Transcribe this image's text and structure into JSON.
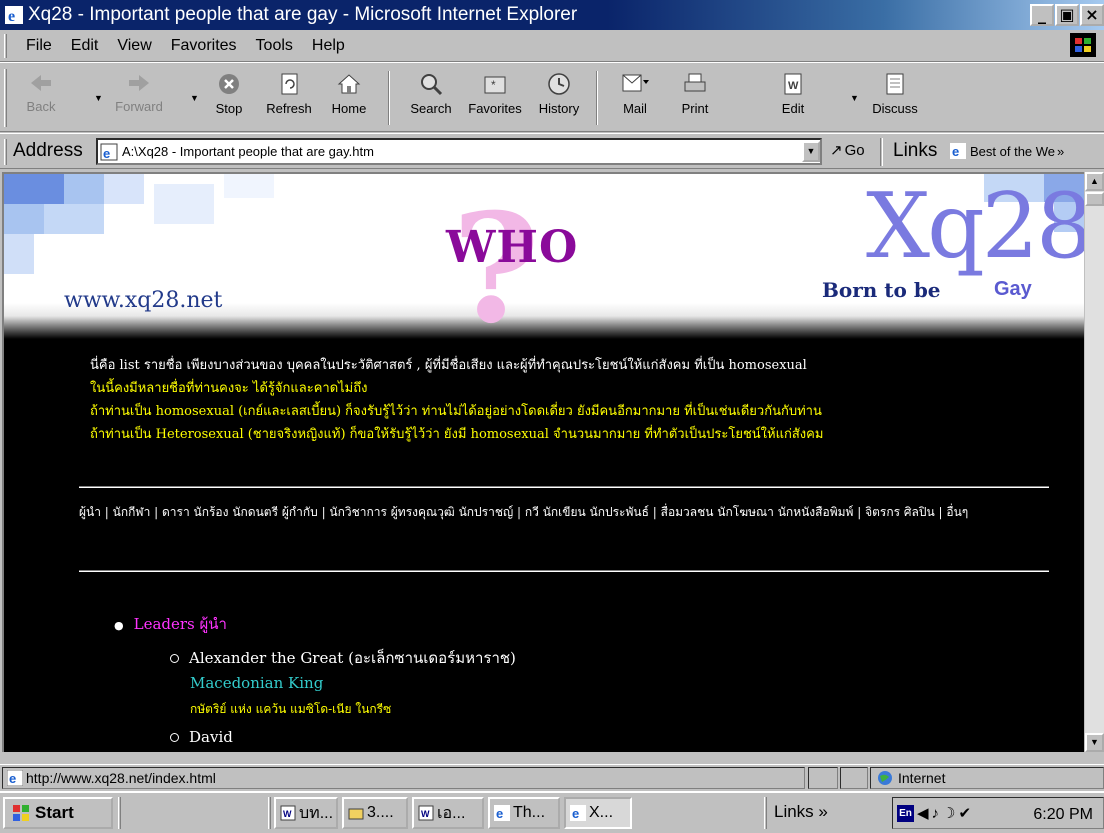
{
  "window": {
    "title": "Xq28 - Important people that are gay - Microsoft Internet Explorer",
    "buttons": {
      "minimize": "_",
      "maximize": "▣",
      "close": "×"
    }
  },
  "menu": {
    "items": [
      "File",
      "Edit",
      "View",
      "Favorites",
      "Tools",
      "Help"
    ]
  },
  "toolbar": {
    "back": "Back",
    "forward": "Forward",
    "stop": "Stop",
    "refresh": "Refresh",
    "home": "Home",
    "search": "Search",
    "favorites": "Favorites",
    "history": "History",
    "mail": "Mail",
    "print": "Print",
    "edit": "Edit",
    "discuss": "Discuss"
  },
  "address": {
    "label": "Address",
    "value": "A:\\Xq28 - Important people that are gay.htm",
    "go": "Go",
    "links_label": "Links",
    "links_item": "Best of the We"
  },
  "page": {
    "banner": {
      "heading": "WHO",
      "site_url": "www.xq28.net",
      "logo": "Xq28",
      "tagline_born": "Born to be",
      "tagline_gay": "Gay"
    },
    "intro": [
      "นี่คือ list รายชื่อ เพียงบางส่วนของ บุคคลในประวัติศาสตร์ , ผู้ที่มีชื่อเสียง และผู้ที่ทำคุณประโยชน์ให้แก่สังคม ที่เป็น homosexual",
      "ในนี้คงมีหลายชื่อที่ท่านคงจะ ได้รู้จักและคาดไม่ถึง",
      "ถ้าท่านเป็น homosexual (เกย์และเลสเบี้ยน) ก็จงรับรู้ไว้ว่า ท่านไม่ได้อยู่อย่างโดดเดี่ยว ยังมีคนอีกมากมาย ที่เป็นเช่นเดียวกันกับท่าน",
      "ถ้าท่านเป็น Heterosexual (ชายจริงหญิงแท้) ก็ขอให้รับรู้ไว้ว่า ยังมี homosexual จำนวนมากมาย ที่ทำตัวเป็นประโยชน์ให้แก่สังคม"
    ],
    "categories": "ผู้นำ | นักกีฬา | ดารา นักร้อง นักดนตรี ผู้กำกับ | นักวิชาการ ผู้ทรงคุณวุฒิ นักปราชญ์ | กวี นักเขียน นักประพันธ์ | สื่อมวลชน นักโฆษณา นักหนังสือพิมพ์ | จิตรกร ศิลปิน | อื่นๆ",
    "list": {
      "section": "Leaders ผู้นำ",
      "entries": [
        {
          "name": "Alexander the Great (อะเล็กซานเดอร์มหาราช)",
          "title_en": "Macedonian King",
          "title_th": "กษัตริย์ แห่ง แคว้น แมซิโด-เนีย ในกรีซ"
        },
        {
          "name": "David"
        }
      ]
    }
  },
  "status": {
    "url": "http://www.xq28.net/index.html",
    "zone": "Internet"
  },
  "taskbar": {
    "start": "Start",
    "tasks": [
      "บท...",
      "3....",
      "เอ...",
      "Th...",
      "X..."
    ],
    "links": "Links »",
    "tray_lang": "En",
    "clock": "6:20 PM"
  },
  "colors": {
    "titlebar": "#0a246a",
    "banner_heading": "#8a0a9a",
    "intro_yellow": "#ffff00",
    "leaders_magenta": "#ff33ff",
    "cyan_title": "#33cccc"
  }
}
